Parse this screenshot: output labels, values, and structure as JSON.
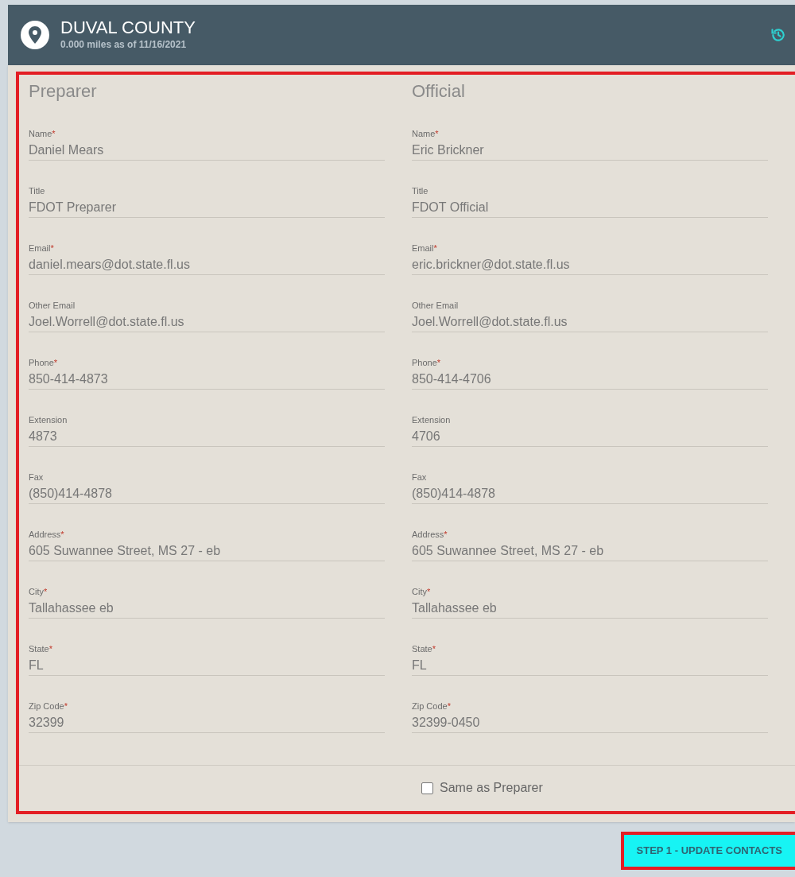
{
  "header": {
    "title": "DUVAL COUNTY",
    "subtitle": "0.000 miles as of 11/16/2021"
  },
  "columns": [
    {
      "heading": "Preparer",
      "fields": [
        {
          "label": "Name",
          "marker": "*",
          "value": "Daniel Mears"
        },
        {
          "label": "Title",
          "value": "FDOT Preparer"
        },
        {
          "label": "Email",
          "marker": "*",
          "value": "daniel.mears@dot.state.fl.us"
        },
        {
          "label": "Other Email",
          "value": "Joel.Worrell@dot.state.fl.us"
        },
        {
          "label": "Phone",
          "marker": "*",
          "value": "850-414-4873"
        },
        {
          "label": "Extension",
          "value": "4873"
        },
        {
          "label": "Fax",
          "value": "(850)414-4878"
        },
        {
          "label": "Address",
          "marker": "*",
          "value": "605 Suwannee Street, MS 27 - eb"
        },
        {
          "label": "City",
          "marker": "*",
          "value": "Tallahassee eb"
        },
        {
          "label": "State",
          "marker": "*",
          "value": "FL"
        },
        {
          "label": "Zip Code",
          "marker": "*",
          "value": "32399"
        }
      ]
    },
    {
      "heading": "Official",
      "fields": [
        {
          "label": "Name",
          "marker": "*",
          "value": "Eric Brickner"
        },
        {
          "label": "Title",
          "value": "FDOT Official"
        },
        {
          "label": "Email",
          "marker": "*",
          "value": "eric.brickner@dot.state.fl.us"
        },
        {
          "label": "Other Email",
          "value": "Joel.Worrell@dot.state.fl.us"
        },
        {
          "label": "Phone",
          "marker": "*",
          "value": "850-414-4706"
        },
        {
          "label": "Extension",
          "value": "4706"
        },
        {
          "label": "Fax",
          "value": "(850)414-4878"
        },
        {
          "label": "Address",
          "marker": "*",
          "value": "605 Suwannee Street, MS 27 - eb"
        },
        {
          "label": "City",
          "marker": "*",
          "value": "Tallahassee eb"
        },
        {
          "label": "State",
          "marker": "*",
          "value": "FL"
        },
        {
          "label": "Zip Code",
          "marker": "*",
          "value": "32399-0450"
        }
      ]
    }
  ],
  "same_as_preparer": {
    "label": "Same as Preparer",
    "checked": false
  },
  "action_button": {
    "label": "STEP 1 - UPDATE CONTACTS"
  }
}
